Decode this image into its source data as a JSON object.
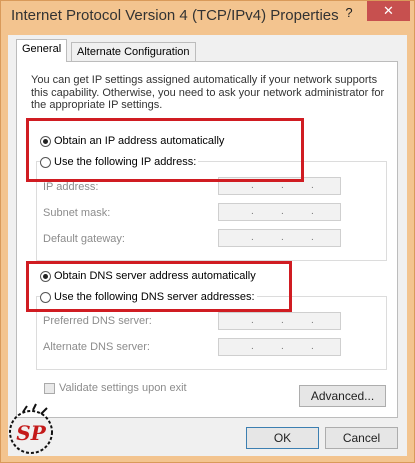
{
  "window": {
    "title": "Internet Protocol Version 4 (TCP/IPv4) Properties",
    "help_label": "?",
    "close_label": "✕"
  },
  "tabs": [
    {
      "label": "General"
    },
    {
      "label": "Alternate Configuration"
    }
  ],
  "intro_text": "You can get IP settings assigned automatically if your network supports this capability. Otherwise, you need to ask your network administrator for the appropriate IP settings.",
  "ip": {
    "auto_label": "Obtain an IP address automatically",
    "manual_label": "Use the following IP address:",
    "fields": [
      {
        "label": "IP address:"
      },
      {
        "label": "Subnet mask:"
      },
      {
        "label": "Default gateway:"
      }
    ]
  },
  "dns": {
    "auto_label": "Obtain DNS server address automatically",
    "manual_label": "Use the following DNS server addresses:",
    "fields": [
      {
        "label": "Preferred DNS server:"
      },
      {
        "label": "Alternate DNS server:"
      }
    ]
  },
  "validate_label": "Validate settings upon exit",
  "buttons": {
    "advanced": "Advanced...",
    "ok": "OK",
    "cancel": "Cancel"
  },
  "watermark": {
    "text": "SP"
  },
  "colors": {
    "highlight": "#d01c22",
    "title_bar": "#f3c48f",
    "close": "#c7504f"
  }
}
